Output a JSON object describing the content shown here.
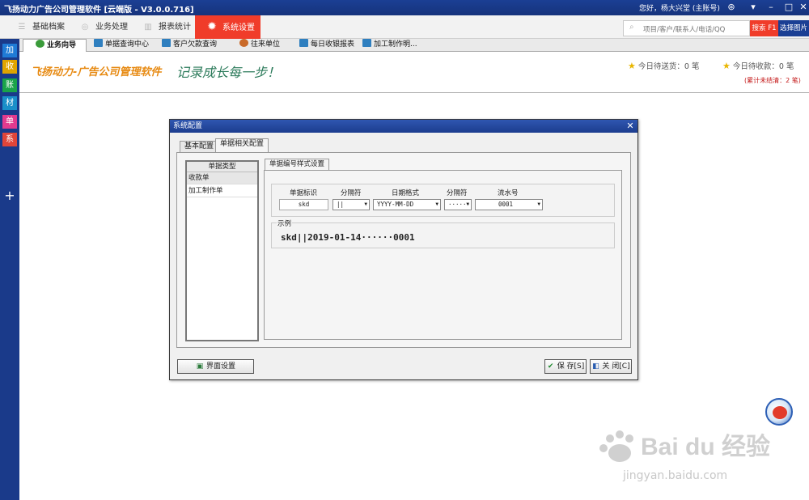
{
  "window": {
    "title": "飞扬动力广告公司管理软件 [云端版 - V3.0.0.716]",
    "user": "您好，杨大兴堂 (主账号)"
  },
  "menubar": {
    "items": [
      {
        "label": "基础档案"
      },
      {
        "label": "业务处理"
      },
      {
        "label": "报表统计"
      },
      {
        "label": "系统设置"
      }
    ],
    "search_placeholder": "项目/客户/联系人/电话/QQ",
    "search_button": "搜索 F1",
    "picture_button": "选择图片"
  },
  "sidebar": {
    "items": [
      {
        "label": "加",
        "color": "#1f7bd6"
      },
      {
        "label": "收",
        "color": "#e0a400"
      },
      {
        "label": "账",
        "color": "#1aa34a"
      },
      {
        "label": "材",
        "color": "#1a8fc9"
      },
      {
        "label": "单",
        "color": "#e23a8e"
      },
      {
        "label": "系",
        "color": "#e0453a"
      }
    ],
    "plus": "+"
  },
  "tabs": [
    {
      "label": "业务向导"
    },
    {
      "label": "单据查询中心"
    },
    {
      "label": "客户欠款查询"
    },
    {
      "label": "往来单位"
    },
    {
      "label": "每日收银报表"
    },
    {
      "label": "加工制作明..."
    }
  ],
  "banner": {
    "logo": "飞扬动力-广告公司管理软件",
    "slogan": "记录成长每一步！",
    "stat_delivery": "今日待送货：0 笔",
    "stat_receivable": "今日待收款：0 笔",
    "unsettled": "(累计未结清：2 笔)"
  },
  "dialog": {
    "title": "系统配置",
    "close": "✕",
    "tabs": [
      {
        "label": "基本配置"
      },
      {
        "label": "单据相关配置"
      }
    ],
    "list_header": "单据类型",
    "list_items": [
      {
        "label": "收款单"
      },
      {
        "label": "加工制作单"
      }
    ],
    "inner_tab": "单据编号样式设置",
    "fields": {
      "id_label": "单据标识",
      "sep1_label": "分隔符",
      "date_label": "日期格式",
      "sep2_label": "分隔符",
      "serial_label": "流水号",
      "id_value": "skd",
      "sep1_value": "||",
      "date_value": "YYYY-MM-DD",
      "sep2_value": "······",
      "serial_value": "0001"
    },
    "example_legend": "示例",
    "example_value": "skd||2019-01-14······0001",
    "ui_settings_button": "界面设置",
    "save_button": "保 存[S]",
    "close_button": "关 闭[C]"
  },
  "watermark": {
    "logo": "Bai du 经验",
    "url": "jingyan.baidu.com"
  }
}
